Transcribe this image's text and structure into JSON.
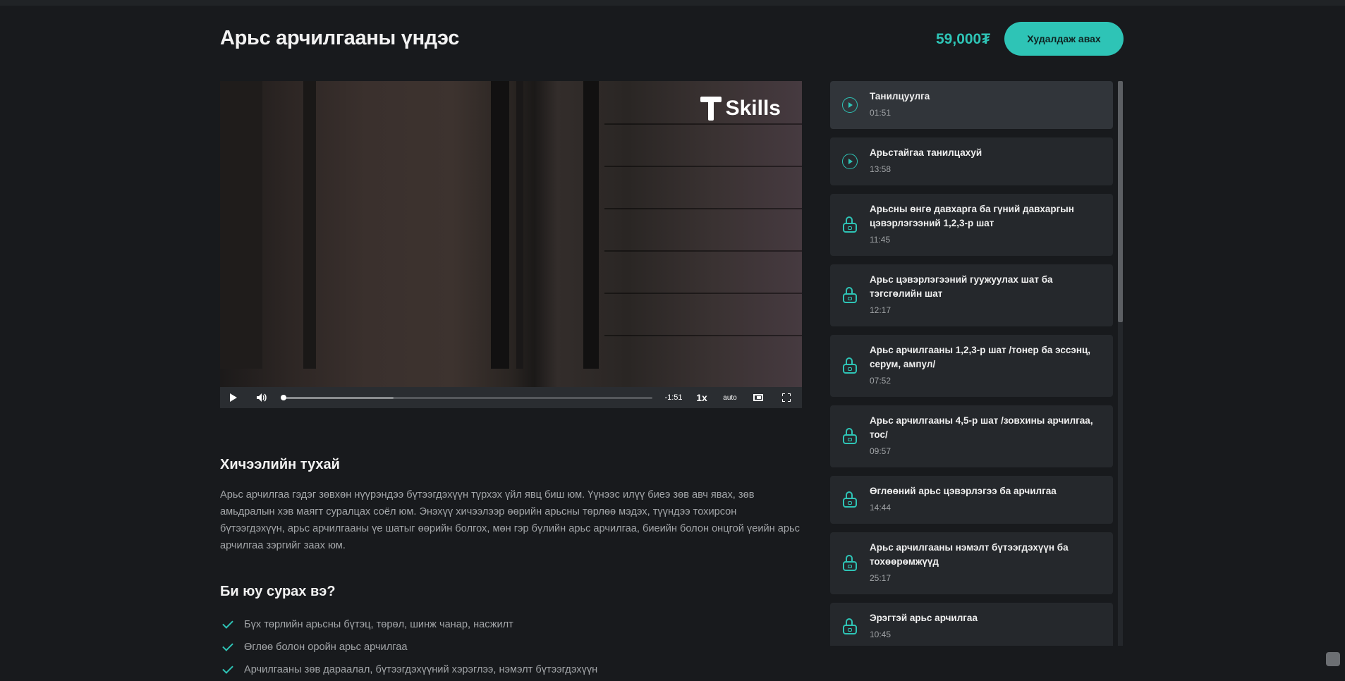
{
  "header": {
    "title": "Арьс арчилгааны үндэс",
    "price": "59,000₮",
    "buy_label": "Худалдаж авах"
  },
  "video": {
    "logo_text": "Skills",
    "time_remaining": "-1:51",
    "speed": "1x",
    "quality": "auto",
    "progress_fraction": 0.0,
    "buffered_fraction": 0.3
  },
  "about": {
    "heading": "Хичээлийн тухай",
    "text": "Арьс арчилгаа гэдэг зөвхөн нүүрэндээ бүтээгдэхүүн түрхэх үйл явц биш юм. Үүнээс илүү биеэ зөв авч явах, зөв амьдралын хэв маягт суралцах соёл юм. Энэхүү хичээлээр өөрийн арьсны төрлөө мэдэх, түүндээ тохирсон бүтээгдэхүүн, арьс арчилгааны үе шатыг өөрийн болгох, мөн гэр бүлийн арьс арчилгаа, биеийн болон онцгой үеийн арьс арчилгаа зэргийг заах юм."
  },
  "learn": {
    "heading": "Би юу сурах вэ?",
    "items": [
      "Бүх төрлийн арьсны бүтэц, төрөл, шинж чанар, насжилт",
      "Өглөө болон оройн арьс арчилгаа",
      "Арчилгааны зөв дараалал, бүтээгдэхүүний хэрэглээ, нэмэлт бүтээгдэхүүн"
    ]
  },
  "playlist": {
    "lessons": [
      {
        "title": "Танилцуулга",
        "time": "01:51",
        "locked": false,
        "active": true
      },
      {
        "title": "Арьстайгаа танилцахуй",
        "time": "13:58",
        "locked": false,
        "active": false
      },
      {
        "title": "Арьсны өнгө давхарга ба гүний давхаргын цэвэрлэгээний 1,2,3-р шат",
        "time": "11:45",
        "locked": true,
        "active": false
      },
      {
        "title": "Арьс цэвэрлэгээний гуужуулах шат ба тэгсгөлийн шат",
        "time": "12:17",
        "locked": true,
        "active": false
      },
      {
        "title": "Арьс арчилгааны 1,2,3-р шат /тонер ба эссэнц, серум, ампул/",
        "time": "07:52",
        "locked": true,
        "active": false
      },
      {
        "title": "Арьс арчилгааны 4,5-р шат /зовхины арчилгаа, тос/",
        "time": "09:57",
        "locked": true,
        "active": false
      },
      {
        "title": "Өглөөний арьс цэвэрлэгээ ба арчилгаа",
        "time": "14:44",
        "locked": true,
        "active": false
      },
      {
        "title": "Арьс арчилгааны нэмэлт бүтээгдэхүүн ба тохөөрөмжүүд",
        "time": "25:17",
        "locked": true,
        "active": false
      },
      {
        "title": "Эрэгтэй арьс арчилгаа",
        "time": "10:45",
        "locked": true,
        "active": false
      }
    ]
  },
  "colors": {
    "accent": "#2ec4b6",
    "background": "#181a1d",
    "card": "#25282c"
  }
}
